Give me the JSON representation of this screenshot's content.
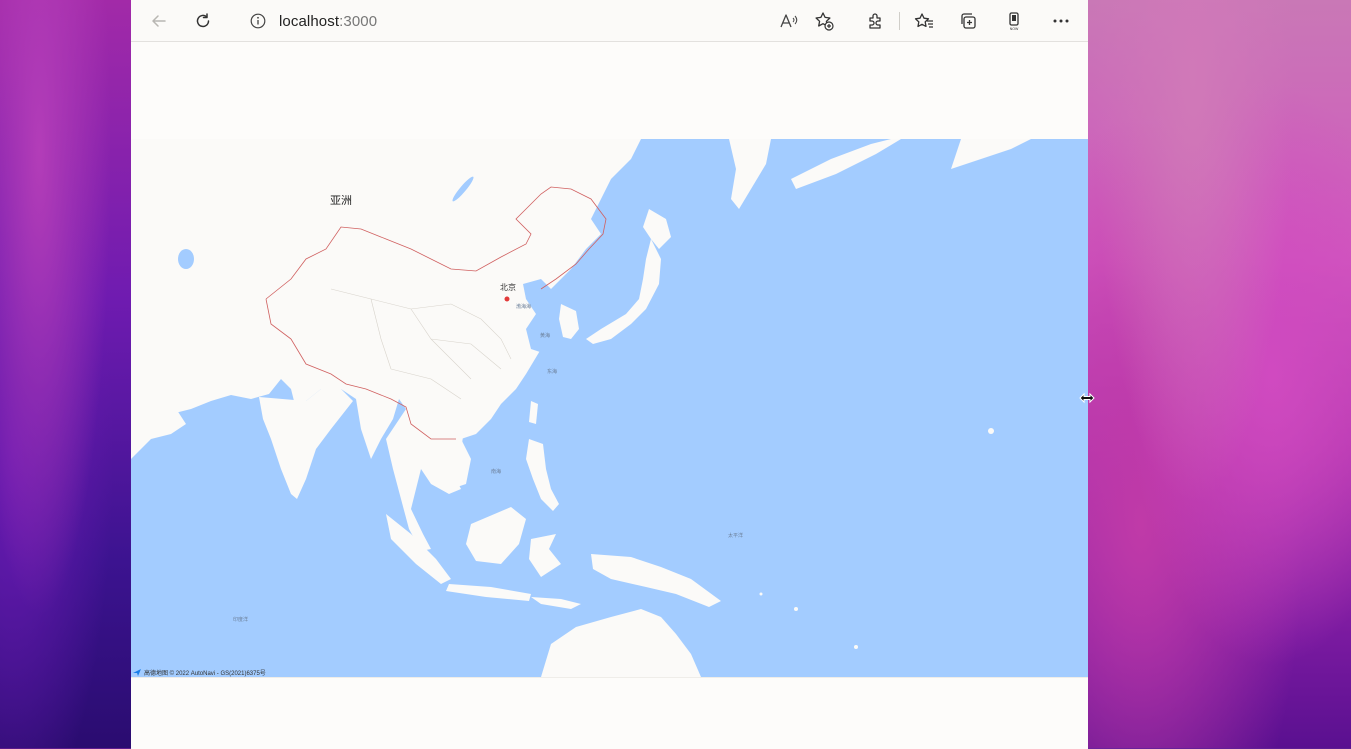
{
  "browser": {
    "url_host": "localhost",
    "url_port": ":3000",
    "icons": [
      "back-arrow-icon",
      "refresh-icon",
      "info-icon",
      "read-aloud-icon",
      "add-favorite-icon",
      "extensions-icon",
      "favorites-icon",
      "collections-icon",
      "phone-icon",
      "more-icon"
    ]
  },
  "map": {
    "continent_label": "亚洲",
    "city_label": "北京",
    "sea_labels": {
      "bohai": "渤海海",
      "yellow_sea": "黄海",
      "east_china_sea": "东海",
      "south_china_sea": "南海",
      "pacific": "太平洋",
      "indian": "印度洋"
    },
    "attribution": "高德地图 © 2022 AutoNavi - GS(2021)6375号",
    "colors": {
      "water": "#a3ccff",
      "land": "#fbfaf8",
      "border": "#d06060",
      "marker": "#e23a3a"
    }
  }
}
